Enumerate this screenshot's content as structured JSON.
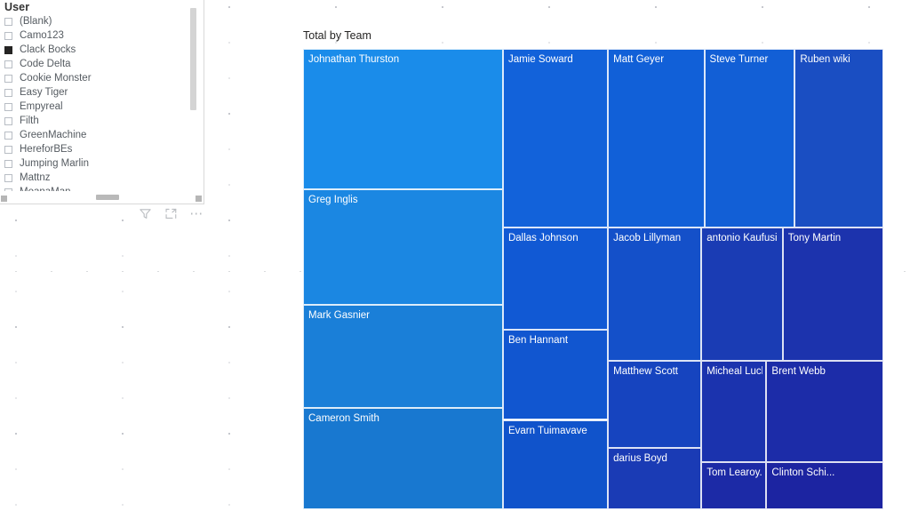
{
  "slicer": {
    "header": "User",
    "items": [
      {
        "label": "(Blank)",
        "checked": false
      },
      {
        "label": "Camo123",
        "checked": false
      },
      {
        "label": "Clack Bocks",
        "checked": true
      },
      {
        "label": "Code Delta",
        "checked": false
      },
      {
        "label": "Cookie Monster",
        "checked": false
      },
      {
        "label": "Easy Tiger",
        "checked": false
      },
      {
        "label": "Empyreal",
        "checked": false
      },
      {
        "label": "Filth",
        "checked": false
      },
      {
        "label": "GreenMachine",
        "checked": false
      },
      {
        "label": "HereforBEs",
        "checked": false
      },
      {
        "label": "Jumping Marlin",
        "checked": false
      },
      {
        "label": "Mattnz",
        "checked": false
      },
      {
        "label": "MoanaMan",
        "checked": false
      }
    ]
  },
  "visual_actions": {
    "filter_label": "Filters",
    "focus_label": "Focus mode",
    "more_label": "More options"
  },
  "chart_data": {
    "type": "treemap",
    "title": "Total by Team",
    "xlabel": "",
    "ylabel": "",
    "colors": {
      "light": "#1a8cea",
      "mid": "#1059d6",
      "dark": "#1835b5",
      "darkest": "#1c25a3"
    },
    "tiles": [
      {
        "label": "Johnathan Thurston",
        "x": 0,
        "y": 0,
        "w": 34.45,
        "h": 30.5,
        "color": "#1a8cea"
      },
      {
        "label": "Greg Inglis",
        "x": 0,
        "y": 30.5,
        "w": 34.45,
        "h": 25.1,
        "color": "#1b87e2"
      },
      {
        "label": "Mark Gasnier",
        "x": 0,
        "y": 55.6,
        "w": 34.45,
        "h": 22.4,
        "color": "#1a7fd8"
      },
      {
        "label": "Cameron Smith",
        "x": 0,
        "y": 78.0,
        "w": 34.45,
        "h": 22.0,
        "color": "#1878d0"
      },
      {
        "label": "Jamie Soward",
        "x": 34.45,
        "y": 0,
        "w": 18.1,
        "h": 38.8,
        "color": "#1262da"
      },
      {
        "label": "Dallas Johnson",
        "x": 34.45,
        "y": 38.8,
        "w": 18.1,
        "h": 22.2,
        "color": "#1159d4"
      },
      {
        "label": "Ben Hannant",
        "x": 34.45,
        "y": 61.0,
        "w": 18.1,
        "h": 19.6,
        "color": "#1156d0"
      },
      {
        "label": "Evarn Tuimavave",
        "x": 34.45,
        "y": 80.6,
        "w": 18.1,
        "h": 19.4,
        "color": "#1053cb"
      },
      {
        "label": "Matt Geyer",
        "x": 52.55,
        "y": 0,
        "w": 16.6,
        "h": 38.8,
        "color": "#1160d8"
      },
      {
        "label": "Jacob Lillyman",
        "x": 52.55,
        "y": 38.8,
        "w": 16.1,
        "h": 29.0,
        "color": "#1450c9"
      },
      {
        "label": "Matthew Scott",
        "x": 52.55,
        "y": 67.8,
        "w": 16.1,
        "h": 18.8,
        "color": "#1644bf"
      },
      {
        "label": "darius Boyd",
        "x": 52.55,
        "y": 86.6,
        "w": 16.1,
        "h": 13.4,
        "color": "#1a3bb5"
      },
      {
        "label": "Steve Turner",
        "x": 69.15,
        "y": 0,
        "w": 15.6,
        "h": 38.8,
        "color": "#125fd6"
      },
      {
        "label": "antonio Kaufusi",
        "x": 68.65,
        "y": 38.8,
        "w": 14.0,
        "h": 29.0,
        "color": "#1a3cb4"
      },
      {
        "label": "Micheal Luck",
        "x": 68.65,
        "y": 67.8,
        "w": 11.2,
        "h": 22.0,
        "color": "#1b33ae"
      },
      {
        "label": "Tom Learoy...",
        "x": 68.65,
        "y": 89.8,
        "w": 11.2,
        "h": 10.2,
        "color": "#1c2aa6"
      },
      {
        "label": "Ruben wiki",
        "x": 84.75,
        "y": 0,
        "w": 15.25,
        "h": 38.8,
        "color": "#1a4ec2"
      },
      {
        "label": "Tony Martin",
        "x": 82.65,
        "y": 38.8,
        "w": 17.35,
        "h": 29.0,
        "color": "#1c33ad"
      },
      {
        "label": "Brent Webb",
        "x": 79.85,
        "y": 67.8,
        "w": 20.15,
        "h": 22.0,
        "color": "#1c2ca8"
      },
      {
        "label": "Clinton Schi...",
        "x": 79.85,
        "y": 89.8,
        "w": 20.15,
        "h": 10.2,
        "color": "#1c24a1"
      }
    ]
  }
}
